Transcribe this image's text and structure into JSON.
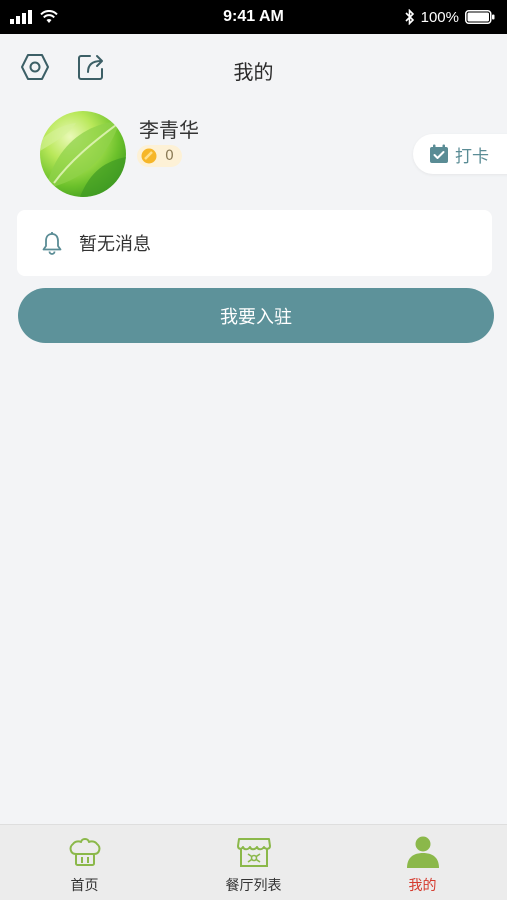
{
  "status_bar": {
    "time": "9:41 AM",
    "battery": "100%"
  },
  "nav": {
    "title": "我的"
  },
  "profile": {
    "name": "李青华",
    "coins": "0"
  },
  "checkin": {
    "label": "打卡"
  },
  "message": {
    "text": "暂无消息"
  },
  "join_button": {
    "label": "我要入驻"
  },
  "tabs": [
    {
      "label": "首页",
      "icon": "chef-hat-icon",
      "active": false
    },
    {
      "label": "餐厅列表",
      "icon": "storefront-icon",
      "active": false
    },
    {
      "label": "我的",
      "icon": "person-icon",
      "active": true
    }
  ],
  "colors": {
    "accent": "#5d929a",
    "active_tab": "#d53a2e",
    "tab_icon": "#8bb84a"
  }
}
